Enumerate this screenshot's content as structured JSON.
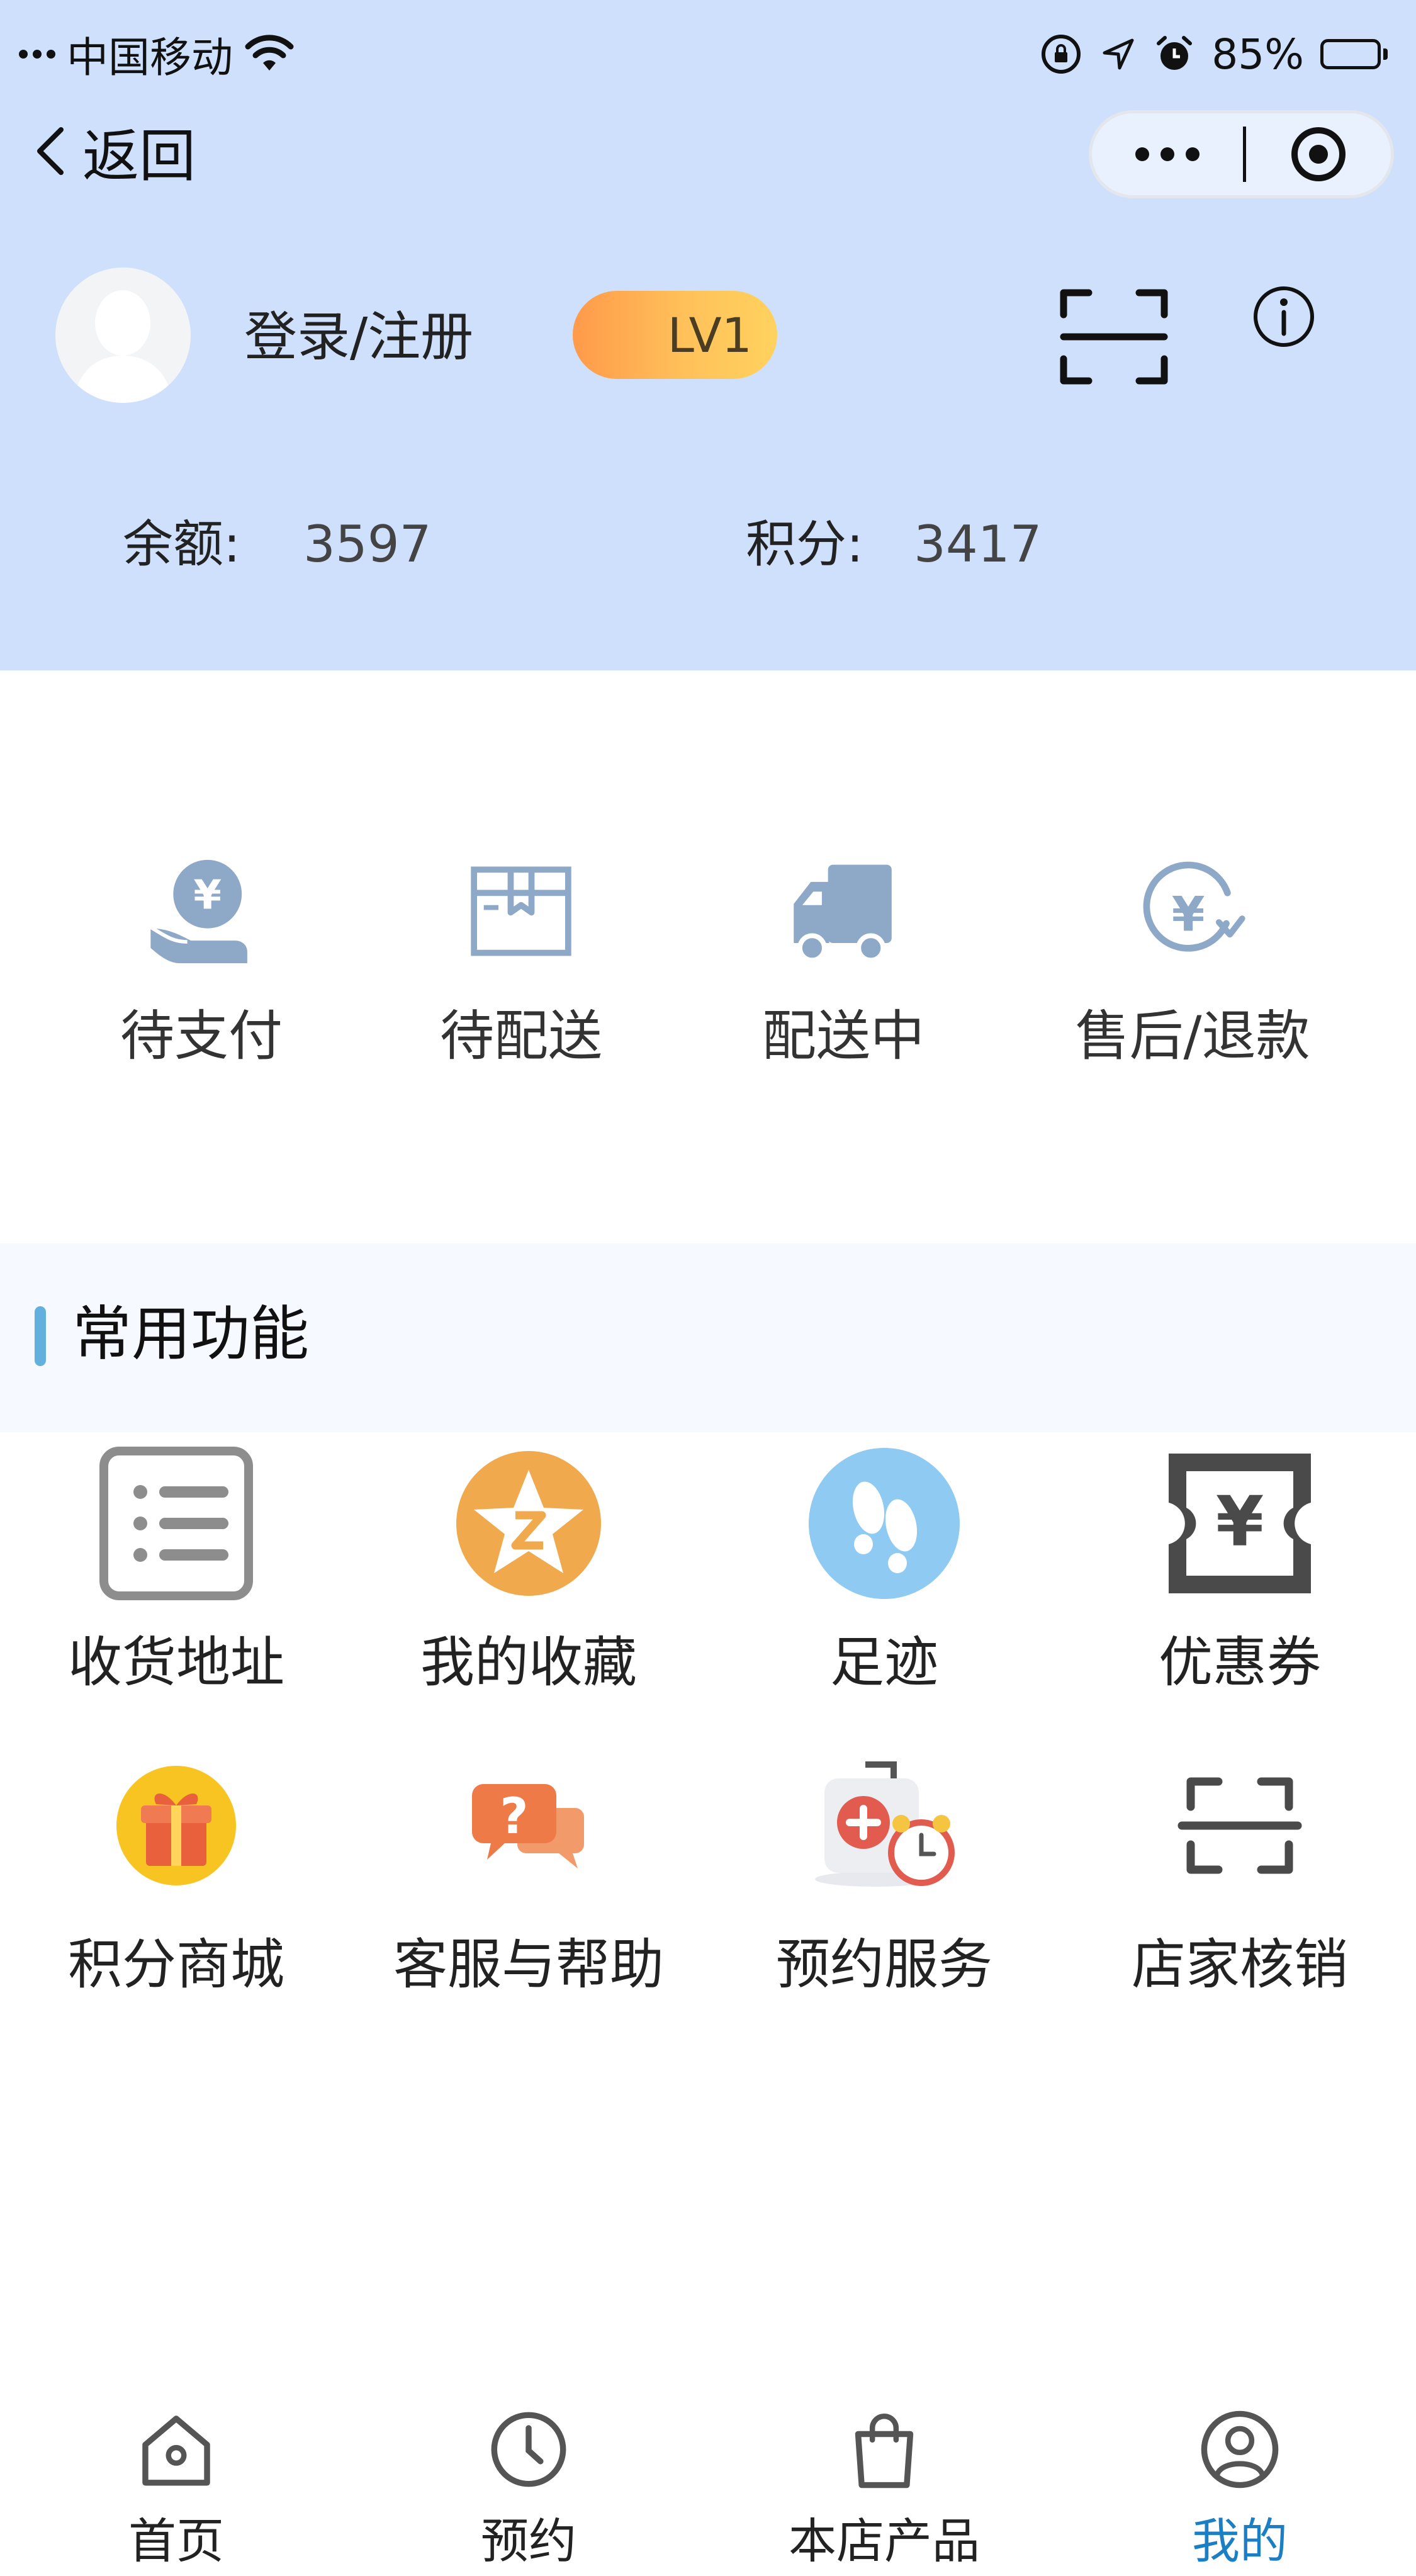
{
  "status_bar": {
    "carrier": "中国移动",
    "battery": "85%",
    "battery_level": 0.85
  },
  "nav": {
    "back_label": "返回"
  },
  "profile": {
    "login_label": "登录/注册",
    "level_badge": "LV1"
  },
  "stats": {
    "balance_label": "余额:",
    "balance_value": "3597",
    "points_label": "积分:",
    "points_value": "3417"
  },
  "orders": [
    {
      "label": "待支付",
      "icon": "yen-hand-icon"
    },
    {
      "label": "待配送",
      "icon": "package-box-icon"
    },
    {
      "label": "配送中",
      "icon": "delivery-truck-icon"
    },
    {
      "label": "售后/退款",
      "icon": "yen-refund-icon"
    }
  ],
  "common": {
    "title": "常用功能",
    "items": [
      {
        "label": "收货地址",
        "icon": "address-list-icon"
      },
      {
        "label": "我的收藏",
        "icon": "favorite-star-icon"
      },
      {
        "label": "足迹",
        "icon": "footprint-icon"
      },
      {
        "label": "优惠券",
        "icon": "coupon-icon"
      },
      {
        "label": "积分商城",
        "icon": "gift-icon"
      },
      {
        "label": "客服与帮助",
        "icon": "help-chat-icon"
      },
      {
        "label": "预约服务",
        "icon": "medical-alarm-icon"
      },
      {
        "label": "店家核销",
        "icon": "scan-icon"
      }
    ]
  },
  "tabs": [
    {
      "label": "首页",
      "icon": "home-icon"
    },
    {
      "label": "预约",
      "icon": "clock-icon"
    },
    {
      "label": "本店产品",
      "icon": "shopping-bag-icon"
    },
    {
      "label": "我的",
      "icon": "user-icon"
    }
  ],
  "colors": {
    "header_bg": "#cfe0fc",
    "accent": "#1a7fc4",
    "order_icon": "#8ea9c7",
    "section_bar": "#63b0de"
  }
}
